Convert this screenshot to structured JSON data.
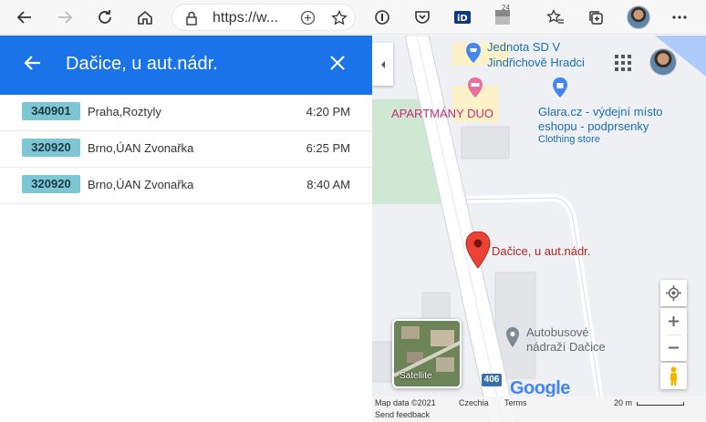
{
  "browser": {
    "url": "https://w...",
    "extension_badge": "24"
  },
  "panel": {
    "title": "Dačice, u aut.nádr.",
    "departures": [
      {
        "line": "340901",
        "destination": "Praha,Roztyly",
        "time": "4:20 PM"
      },
      {
        "line": "320920",
        "destination": "Brno,ÚAN Zvonařka",
        "time": "6:25 PM"
      },
      {
        "line": "320920",
        "destination": "Brno,ÚAN Zvonařka",
        "time": "8:40 AM"
      }
    ]
  },
  "map": {
    "poi_jednota_line1": "Jednota SD V",
    "poi_jednota_line2": "Jindřichově Hradci",
    "poi_apartmany": "APARTMÁNY DUO",
    "poi_glara_line1": "Glara.cz - výdejní místo",
    "poi_glara_line2": "eshopu - podprsenky",
    "poi_glara_category": "Clothing store",
    "selected_stop": "Dačice, u aut.nádr.",
    "poi_bus_station_line1": "Autobusové",
    "poi_bus_station_line2": "nádraží Dačice",
    "road_number": "406",
    "satellite_label": "Satellite",
    "logo": "Google",
    "footer_data": "Map data ©2021",
    "footer_country": "Czechia",
    "footer_terms": "Terms",
    "footer_scale": "20 m",
    "footer_feedback": "Send feedback",
    "colors": {
      "header_blue": "#1a73e8",
      "badge": "#7ec6d4",
      "pin": "#d93025",
      "poi_pink": "#c5306e",
      "poi_blue": "#1a6fb5"
    }
  }
}
